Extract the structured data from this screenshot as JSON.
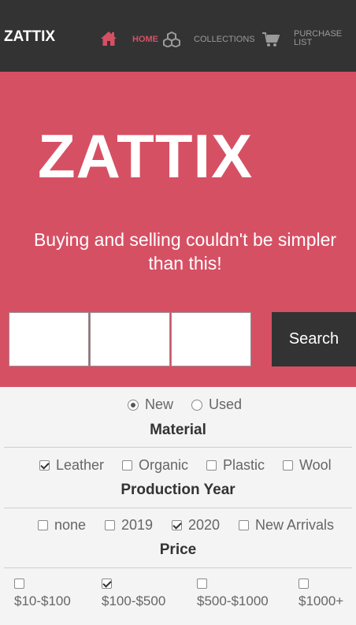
{
  "nav": {
    "brand": "ZATTIX",
    "home_label": "HOME",
    "collections_label": "COLLECTIONS",
    "purchase_label": "PURCHASE LIST",
    "active_color": "#d65064",
    "icons": [
      "home-icon",
      "collections-icon",
      "cart-icon"
    ]
  },
  "hero": {
    "title": "ZATTIX",
    "subtitle": "Buying and selling couldn't be simpler than this!",
    "background": "#d65064",
    "search_button": "Search"
  },
  "filters": {
    "condition": [
      {
        "label": "New",
        "checked": true
      },
      {
        "label": "Used",
        "checked": false
      }
    ],
    "material_title": "Material",
    "materials": [
      {
        "label": "Leather",
        "checked": true
      },
      {
        "label": "Organic",
        "checked": false
      },
      {
        "label": "Plastic",
        "checked": false
      },
      {
        "label": "Wool",
        "checked": false
      }
    ],
    "year_title": "Production Year",
    "years": [
      {
        "label": "none",
        "checked": false
      },
      {
        "label": "2019",
        "checked": false
      },
      {
        "label": "2020",
        "checked": true
      },
      {
        "label": "New Arrivals",
        "checked": false
      }
    ],
    "price_title": "Price",
    "prices": [
      {
        "label": "$10-$100",
        "checked": false
      },
      {
        "label": "$100-$500",
        "checked": true
      },
      {
        "label": "$500-$1000",
        "checked": false
      },
      {
        "label": "$1000+",
        "checked": false
      }
    ]
  }
}
